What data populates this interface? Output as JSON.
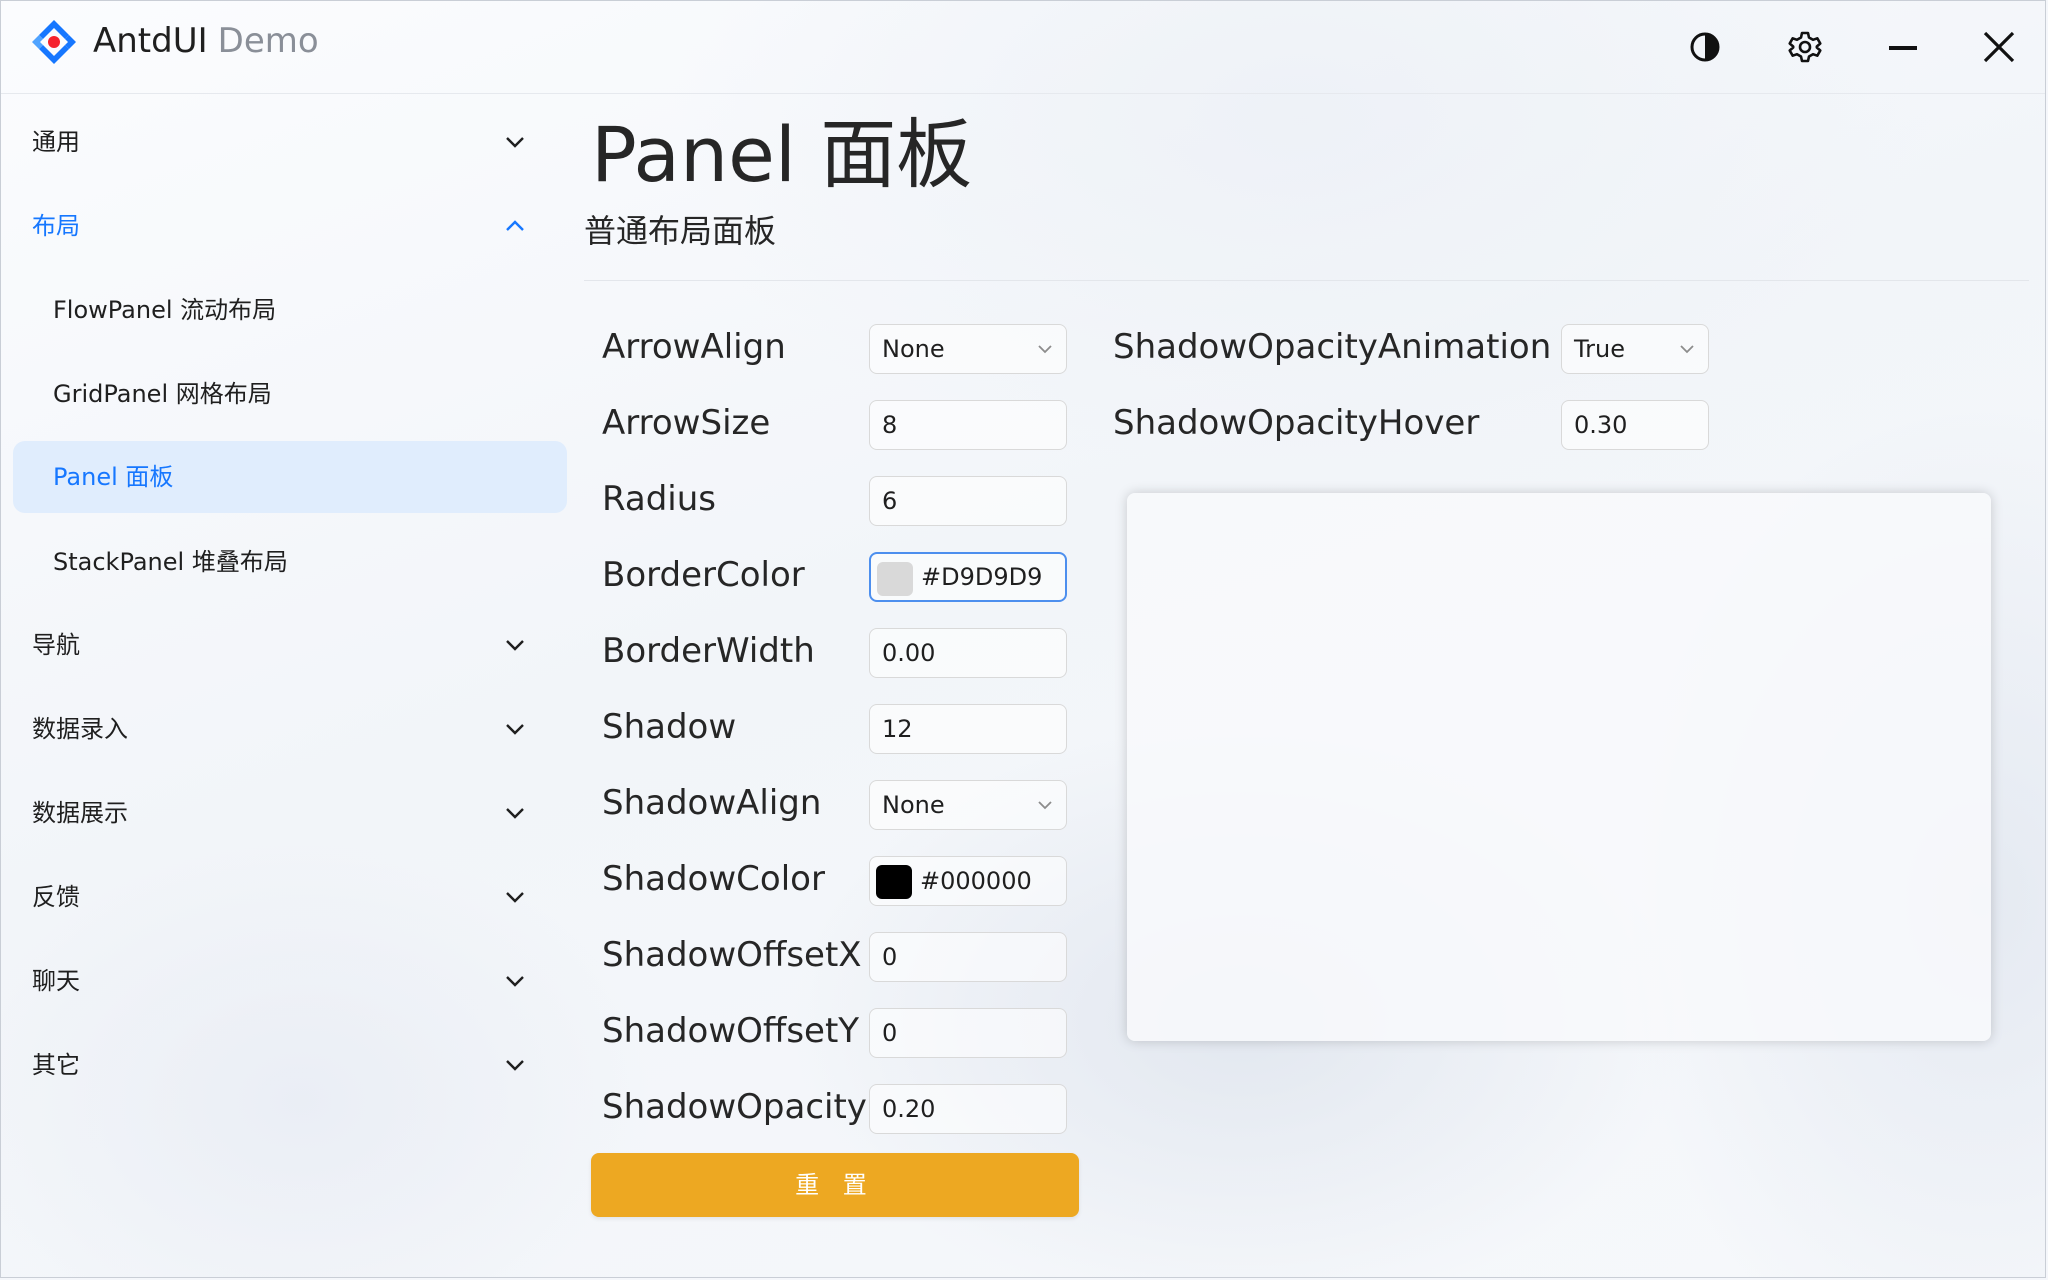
{
  "titlebar": {
    "app_name": "AntdUI",
    "app_suffix": "Demo",
    "logo_icon": "antd-diamond-logo",
    "buttons": [
      "theme-toggle-icon",
      "gear-icon",
      "minimize-icon",
      "close-icon"
    ]
  },
  "sidebar": {
    "items": [
      {
        "label": "通用"
      },
      {
        "label": "布局"
      },
      {
        "label": "FlowPanel 流动布局"
      },
      {
        "label": "GridPanel 网格布局"
      },
      {
        "label": "Panel 面板"
      },
      {
        "label": "StackPanel 堆叠布局"
      },
      {
        "label": "导航"
      },
      {
        "label": "数据录入"
      },
      {
        "label": "数据展示"
      },
      {
        "label": "反馈"
      },
      {
        "label": "聊天"
      },
      {
        "label": "其它"
      }
    ]
  },
  "main": {
    "title": "Panel 面板",
    "subtitle": "普通布局面板",
    "props_left": [
      {
        "label": "ArrowAlign",
        "value": "None"
      },
      {
        "label": "ArrowSize",
        "value": "8"
      },
      {
        "label": "Radius",
        "value": "6"
      },
      {
        "label": "BorderColor",
        "value": "#D9D9D9"
      },
      {
        "label": "BorderWidth",
        "value": "0.00"
      },
      {
        "label": "Shadow",
        "value": "12"
      },
      {
        "label": "ShadowAlign",
        "value": "None"
      },
      {
        "label": "ShadowColor",
        "value": "#000000"
      },
      {
        "label": "ShadowOffsetX",
        "value": "0"
      },
      {
        "label": "ShadowOffsetY",
        "value": "0"
      },
      {
        "label": "ShadowOpacity",
        "value": "0.20"
      }
    ],
    "props_right": [
      {
        "label": "ShadowOpacityAnimation",
        "value": "True"
      },
      {
        "label": "ShadowOpacityHover",
        "value": "0.30"
      }
    ],
    "reset_label": "重 置"
  },
  "colors": {
    "accent": "#1677ff",
    "active_bg": "#e0edfd",
    "reset_button": "#eda822",
    "border_color_swatch": "#D9D9D9",
    "shadow_color_swatch": "#000000"
  }
}
